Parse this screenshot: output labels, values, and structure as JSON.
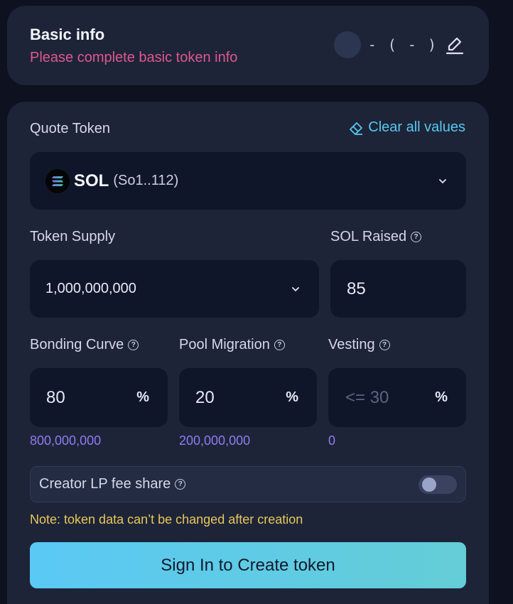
{
  "basic_info": {
    "title": "Basic info",
    "subtitle": "Please complete basic token info",
    "preview_text": "- ( - )"
  },
  "form": {
    "quote_token_label": "Quote Token",
    "clear_label": "Clear all values",
    "quote_token": {
      "symbol": "SOL",
      "address": "(So1..112)"
    },
    "token_supply_label": "Token Supply",
    "token_supply_value": "1,000,000,000",
    "sol_raised_label": "SOL Raised",
    "sol_raised_value": "85",
    "bonding_curve_label": "Bonding Curve",
    "bonding_curve_value": "80",
    "bonding_curve_amount": "800,000,000",
    "pool_migration_label": "Pool Migration",
    "pool_migration_value": "20",
    "pool_migration_amount": "200,000,000",
    "vesting_label": "Vesting",
    "vesting_placeholder": "<= 30",
    "vesting_amount": "0",
    "percent_symbol": "%",
    "help_symbol": "?",
    "creator_lp_label": "Creator LP fee share",
    "creator_lp_enabled": false,
    "note": "Note: token data can’t be changed after creation",
    "submit_label": "Sign In to Create token"
  },
  "colors": {
    "accent_link": "#56c7ef",
    "warning_text": "#e0578f",
    "note_text": "#e9c75a",
    "amount_text": "#8f7cf2",
    "cta_gradient_start": "#5ac9f5",
    "cta_gradient_end": "#64cdd6"
  }
}
